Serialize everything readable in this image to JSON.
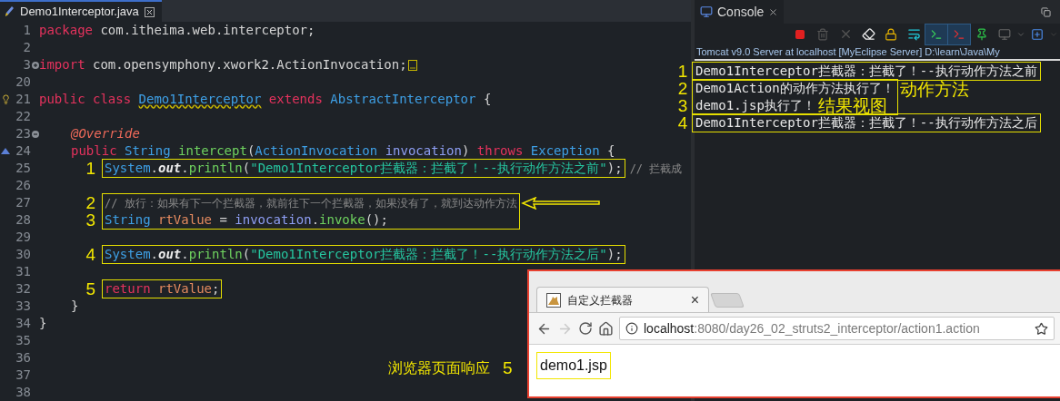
{
  "editor": {
    "tab": {
      "title": "Demo1Interceptor.java"
    },
    "lines": [
      {
        "kind": "line",
        "num": "1",
        "tokens": [
          {
            "kind": "k",
            "text": "package"
          },
          {
            "kind": "p",
            "text": " com.itheima.web.interceptor;"
          }
        ]
      },
      {
        "kind": "line",
        "num": "2"
      },
      {
        "kind": "line",
        "num": "3",
        "gutter": {
          "kind": "fold"
        },
        "collapsed": true,
        "tokens": [
          {
            "kind": "k",
            "text": "import"
          },
          {
            "kind": "p",
            "text": " com.opensymphony.xwork2.ActionInvocation;"
          }
        ]
      },
      {
        "kind": "line",
        "num": "20"
      },
      {
        "kind": "line",
        "num": "21",
        "gutter": {
          "kind": "hint"
        },
        "tokens": [
          {
            "kind": "k",
            "text": "public class "
          },
          {
            "kind": "w",
            "text": "Demo1Interceptor"
          },
          {
            "kind": "k",
            "text": " extends "
          },
          {
            "kind": "t",
            "text": "AbstractInterceptor"
          },
          {
            "kind": "p",
            "text": " {"
          }
        ],
        "children": [
          {
            "kind": "line",
            "num": "22"
          },
          {
            "kind": "line",
            "num": "23",
            "gutter": {
              "kind": "unfold"
            },
            "tokens": [
              {
                "kind": "a",
                "text": "@Override"
              }
            ]
          },
          {
            "kind": "line",
            "num": "24",
            "gutter": {
              "kind": "marker"
            },
            "tokens": [
              {
                "kind": "k",
                "text": "public "
              },
              {
                "kind": "t",
                "text": "String "
              },
              {
                "kind": "f",
                "text": "intercept"
              },
              {
                "kind": "p",
                "text": "("
              },
              {
                "kind": "t",
                "text": "ActionInvocation "
              },
              {
                "kind": "i",
                "text": "invocation"
              },
              {
                "kind": "p",
                "text": ") "
              },
              {
                "kind": "k",
                "text": "throws "
              },
              {
                "kind": "t",
                "text": "Exception"
              },
              {
                "kind": "p",
                "text": " {"
              }
            ],
            "children": [
              {
                "kind": "box",
                "arrow": false,
                "lines": [
                  {
                    "num": "25",
                    "marker": "1",
                    "tokens": [
                      {
                        "kind": "t",
                        "text": "System"
                      },
                      {
                        "kind": "p",
                        "text": "."
                      },
                      {
                        "kind": "o",
                        "text": "out"
                      },
                      {
                        "kind": "p",
                        "text": "."
                      },
                      {
                        "kind": "f",
                        "text": "println"
                      },
                      {
                        "kind": "p",
                        "text": "("
                      },
                      {
                        "kind": "s",
                        "text": "\"Demo1Interceptor拦截器：拦截了！--执行动作方法之前\""
                      },
                      {
                        "kind": "p",
                        "text": ");"
                      }
                    ],
                    "after": [
                      {
                        "kind": "c",
                        "text": "// 拦截成"
                      }
                    ]
                  }
                ]
              },
              {
                "kind": "line",
                "num": "26"
              },
              {
                "kind": "box",
                "arrow": true,
                "lines": [
                  {
                    "num": "27",
                    "marker": "2",
                    "tokens": [
                      {
                        "kind": "c",
                        "text": "// 放行：如果有下一个拦截器，就前往下一个拦截器，如果没有了，就到达动作方法"
                      }
                    ]
                  },
                  {
                    "num": "28",
                    "marker": "3",
                    "tokens": [
                      {
                        "kind": "t",
                        "text": "String "
                      },
                      {
                        "kind": "v",
                        "text": "rtValue"
                      },
                      {
                        "kind": "p",
                        "text": " = "
                      },
                      {
                        "kind": "i",
                        "text": "invocation"
                      },
                      {
                        "kind": "p",
                        "text": "."
                      },
                      {
                        "kind": "f",
                        "text": "invoke"
                      },
                      {
                        "kind": "p",
                        "text": "();"
                      }
                    ]
                  }
                ]
              },
              {
                "kind": "line",
                "num": "29"
              },
              {
                "kind": "box",
                "arrow": false,
                "lines": [
                  {
                    "num": "30",
                    "marker": "4",
                    "tokens": [
                      {
                        "kind": "t",
                        "text": "System"
                      },
                      {
                        "kind": "p",
                        "text": "."
                      },
                      {
                        "kind": "o",
                        "text": "out"
                      },
                      {
                        "kind": "p",
                        "text": "."
                      },
                      {
                        "kind": "f",
                        "text": "println"
                      },
                      {
                        "kind": "p",
                        "text": "("
                      },
                      {
                        "kind": "s",
                        "text": "\"Demo1Interceptor拦截器：拦截了！--执行动作方法之后\""
                      },
                      {
                        "kind": "p",
                        "text": ");"
                      }
                    ]
                  }
                ]
              },
              {
                "kind": "line",
                "num": "31"
              },
              {
                "kind": "box",
                "arrow": false,
                "lines": [
                  {
                    "num": "32",
                    "marker": "5",
                    "tokens": [
                      {
                        "kind": "k",
                        "text": "return "
                      },
                      {
                        "kind": "v",
                        "text": "rtValue"
                      },
                      {
                        "kind": "p",
                        "text": ";"
                      }
                    ]
                  }
                ]
              }
            ]
          },
          {
            "kind": "line",
            "num": "33",
            "tokens": [
              {
                "kind": "p",
                "text": "}"
              }
            ]
          }
        ]
      },
      {
        "kind": "line",
        "num": "34",
        "tokens": [
          {
            "kind": "p",
            "text": "}"
          }
        ]
      },
      {
        "kind": "line",
        "num": "35"
      },
      {
        "kind": "line",
        "num": "36"
      },
      {
        "kind": "line",
        "num": "37"
      },
      {
        "kind": "line",
        "num": "38"
      }
    ]
  },
  "console": {
    "title": "Console",
    "server": "Tomcat v9.0 Server at localhost [MyEclipse Server] D:\\learn\\Java\\My",
    "groups": [
      {
        "lines": [
          {
            "marker": "1",
            "text": "Demo1Interceptor拦截器：拦截了！--执行动作方法之前"
          }
        ]
      },
      {
        "lines": [
          {
            "marker": "2",
            "text": "Demo1Action的动作方法执行了！",
            "note": "动作方法",
            "note_in_box": false
          },
          {
            "marker": "3",
            "text": "demo1.jsp执行了！",
            "note": "结果视图",
            "note_in_box": true
          }
        ]
      },
      {
        "lines": [
          {
            "marker": "4",
            "text": "Demo1Interceptor拦截器：拦截了！--执行动作方法之后"
          }
        ]
      }
    ]
  },
  "browser": {
    "tab": {
      "title": "自定义拦截器",
      "close": "×"
    },
    "forward_disabled": true,
    "url": {
      "host": "localhost",
      "rest": ":8080/day26_02_struts2_interceptor/action1.action"
    },
    "page": {
      "text": "demo1.jsp"
    }
  },
  "annotation": {
    "label": "浏览器页面响应",
    "marker": "5"
  }
}
